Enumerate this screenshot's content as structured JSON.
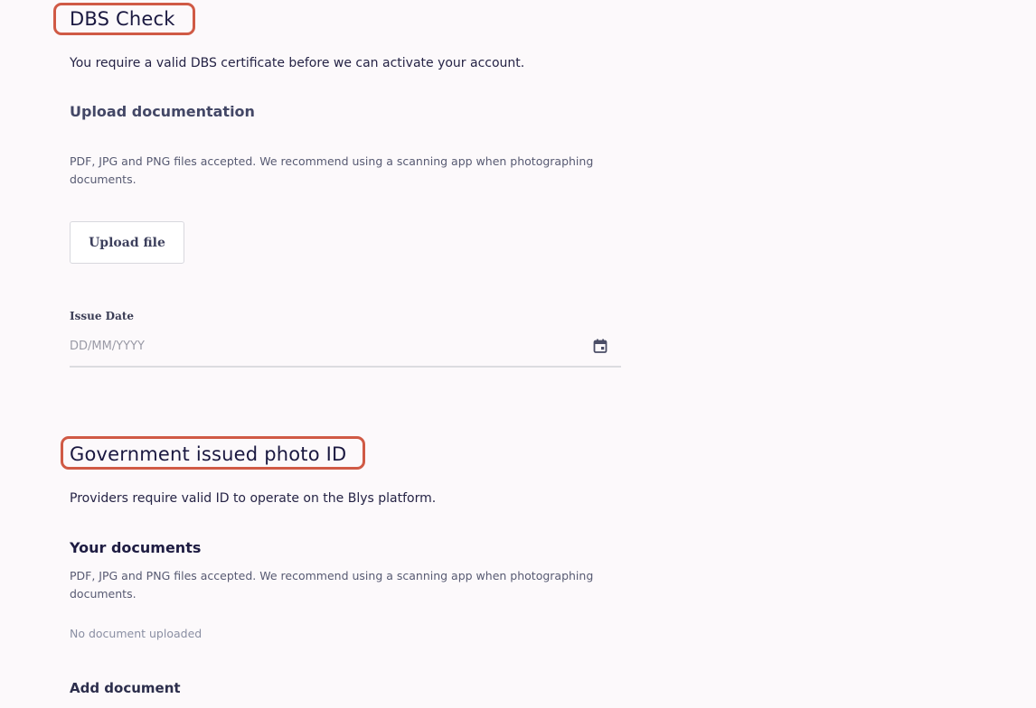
{
  "dbs": {
    "title": "DBS Check",
    "intro": "You require a valid DBS certificate before we can activate your account.",
    "upload_heading": "Upload documentation",
    "file_note": "PDF, JPG and PNG files accepted. We recommend using a scanning app when photographing documents.",
    "upload_button_label": "Upload file",
    "issue_date_label": "Issue Date",
    "issue_date_placeholder": "DD/MM/YYYY",
    "issue_date_value": ""
  },
  "photo_id": {
    "title": "Government issued photo ID",
    "intro": "Providers require valid ID to operate on the Blys platform.",
    "documents_heading": "Your documents",
    "file_note": "PDF, JPG and PNG files accepted. We recommend using a scanning app when photographing documents.",
    "empty_state": "No document uploaded",
    "add_document_label": "Add document"
  },
  "icons": {
    "issue_date_picker": "calendar-icon"
  },
  "colors": {
    "highlight": "#d05a45",
    "background": "#fcf9fb",
    "heading": "#1a1840"
  }
}
